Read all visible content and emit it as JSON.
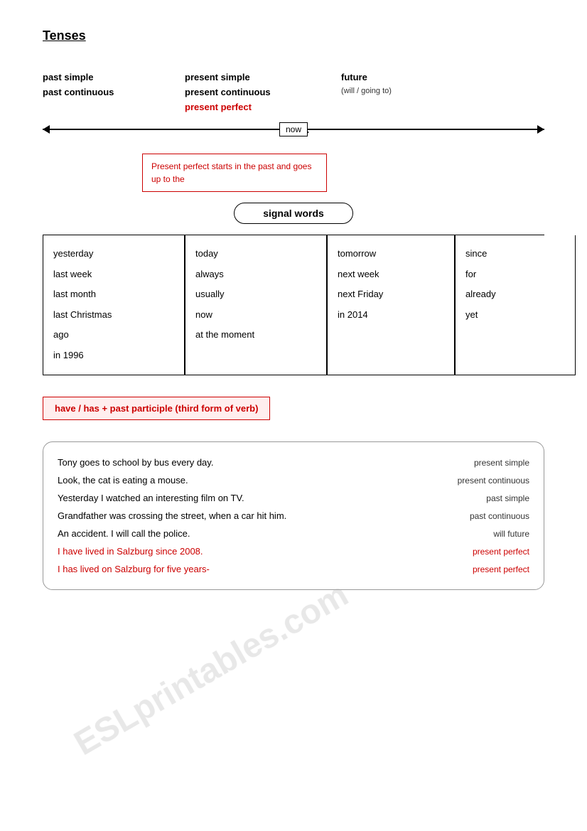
{
  "title": "Tenses",
  "tenses": {
    "row1": {
      "col1": "past simple",
      "col2": "present simple",
      "col3": "future"
    },
    "row2": {
      "col1": "past continuous",
      "col2": "present continuous",
      "col3": "(will / going to)"
    },
    "row3": {
      "col2": "present perfect"
    }
  },
  "now_label": "now",
  "present_perfect_note": "Present perfect starts in the past and goes up to the",
  "signal_words_label": "signal words",
  "signal_boxes": [
    {
      "words": [
        "yesterday",
        "last week",
        "last month",
        "last Christmas",
        "ago",
        "in 1996"
      ]
    },
    {
      "words": [
        "today",
        "always",
        "usually",
        "",
        "now",
        "at the moment"
      ]
    },
    {
      "words": [
        "tomorrow",
        "next week",
        "next Friday",
        "in 2014"
      ]
    },
    {
      "words": [
        "since",
        "for",
        "already",
        "yet"
      ]
    }
  ],
  "formula": "have / has + past participle (third form of verb)",
  "examples": [
    {
      "sentence": "Tony goes to school by bus every day.",
      "tense": "present simple",
      "red": false
    },
    {
      "sentence": "Look, the cat is eating a mouse.",
      "tense": "present continuous",
      "red": false
    },
    {
      "sentence": "Yesterday I watched an interesting film on TV.",
      "tense": "past simple",
      "red": false
    },
    {
      "sentence": "Grandfather was crossing the street, when a car hit him.",
      "tense": "past continuous",
      "red": false
    },
    {
      "sentence": "An accident. I will call the police.",
      "tense": "will future",
      "red": false
    },
    {
      "sentence": "I have lived in Salzburg since 2008.",
      "tense": "present perfect",
      "red": true
    },
    {
      "sentence": "I has lived on Salzburg for five years-",
      "tense": "present perfect",
      "red": true
    }
  ]
}
